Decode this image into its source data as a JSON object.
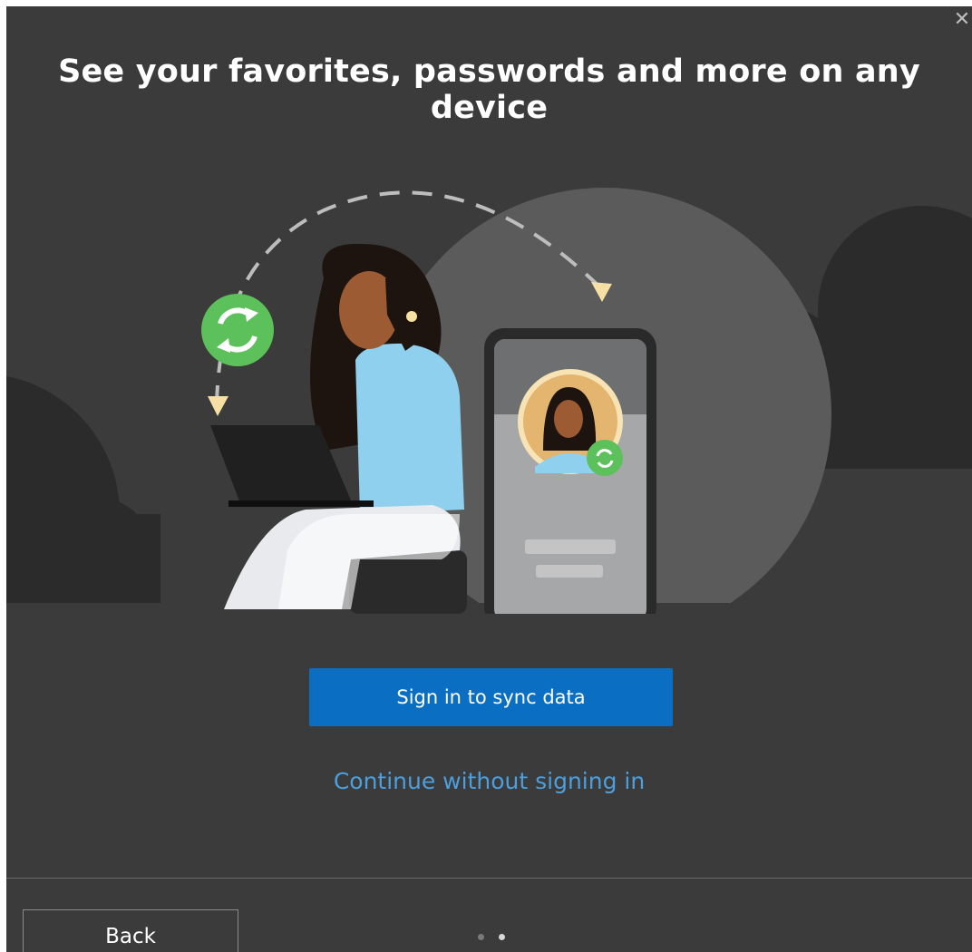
{
  "dialog": {
    "close_glyph": "✕",
    "title": "See your favorites, passwords and more on any device",
    "primary_button": "Sign in to sync data",
    "secondary_link": "Continue without signing in",
    "back_button": "Back",
    "pager": {
      "total": 2,
      "current": 2
    }
  },
  "illustration": {
    "sync_icon": "sync-icon",
    "accent_green": "#5cc15a",
    "accent_blue": "#8fd0ef",
    "background": "#3b3b3b"
  },
  "colors": {
    "primary_button": "#0a6fc2",
    "link": "#4c9fdc",
    "text": "#ffffff"
  }
}
